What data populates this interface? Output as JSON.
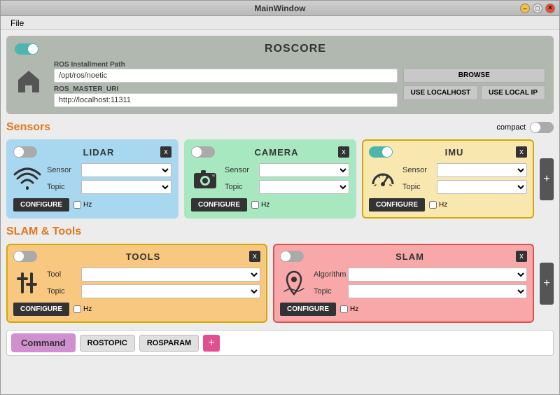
{
  "window": {
    "title": "MainWindow",
    "menu": {
      "items": [
        {
          "label": "File"
        }
      ]
    }
  },
  "roscore": {
    "title": "ROSCORE",
    "toggle_state": "on",
    "ros_install_path": {
      "label": "ROS Installment Path",
      "value": "/opt/ros/noetic",
      "placeholder": "/opt/ros/noetic"
    },
    "ros_master_uri": {
      "label": "ROS_MASTER_URI",
      "value": "http://localhost:11311",
      "placeholder": "http://localhost:11311"
    },
    "buttons": {
      "browse": "BROWSE",
      "use_localhost": "USE LOCALHOST",
      "use_local_ip": "USE LOCAL IP"
    }
  },
  "sensors": {
    "section_title": "Sensors",
    "compact_label": "compact",
    "cards": [
      {
        "id": "lidar",
        "title": "LIDAR",
        "toggle": "off",
        "sensor_label": "Sensor",
        "topic_label": "Topic",
        "configure_label": "CONFIGURE",
        "hz_label": "Hz",
        "icon_type": "wifi"
      },
      {
        "id": "camera",
        "title": "CAMERA",
        "toggle": "off",
        "sensor_label": "Sensor",
        "topic_label": "Topic",
        "configure_label": "CONFIGURE",
        "hz_label": "Hz",
        "icon_type": "camera"
      },
      {
        "id": "imu",
        "title": "IMU",
        "toggle": "on",
        "sensor_label": "Sensor",
        "topic_label": "Topic",
        "configure_label": "CONFIGURE",
        "hz_label": "Hz",
        "icon_type": "gauge"
      }
    ]
  },
  "slam_tools": {
    "section_title": "SLAM & Tools",
    "cards": [
      {
        "id": "tools",
        "title": "TOOLS",
        "toggle": "off",
        "field1_label": "Tool",
        "field2_label": "Topic",
        "configure_label": "CONFIGURE",
        "hz_label": "Hz",
        "icon_type": "tools"
      },
      {
        "id": "slam",
        "title": "SLAM",
        "toggle": "off",
        "field1_label": "Algorithm",
        "field2_label": "Topic",
        "configure_label": "CONFIGURE",
        "hz_label": "Hz",
        "icon_type": "map"
      }
    ]
  },
  "command": {
    "label": "Command",
    "buttons": [
      "ROSTOPIC",
      "ROSPARAM"
    ],
    "plus_label": "+"
  }
}
